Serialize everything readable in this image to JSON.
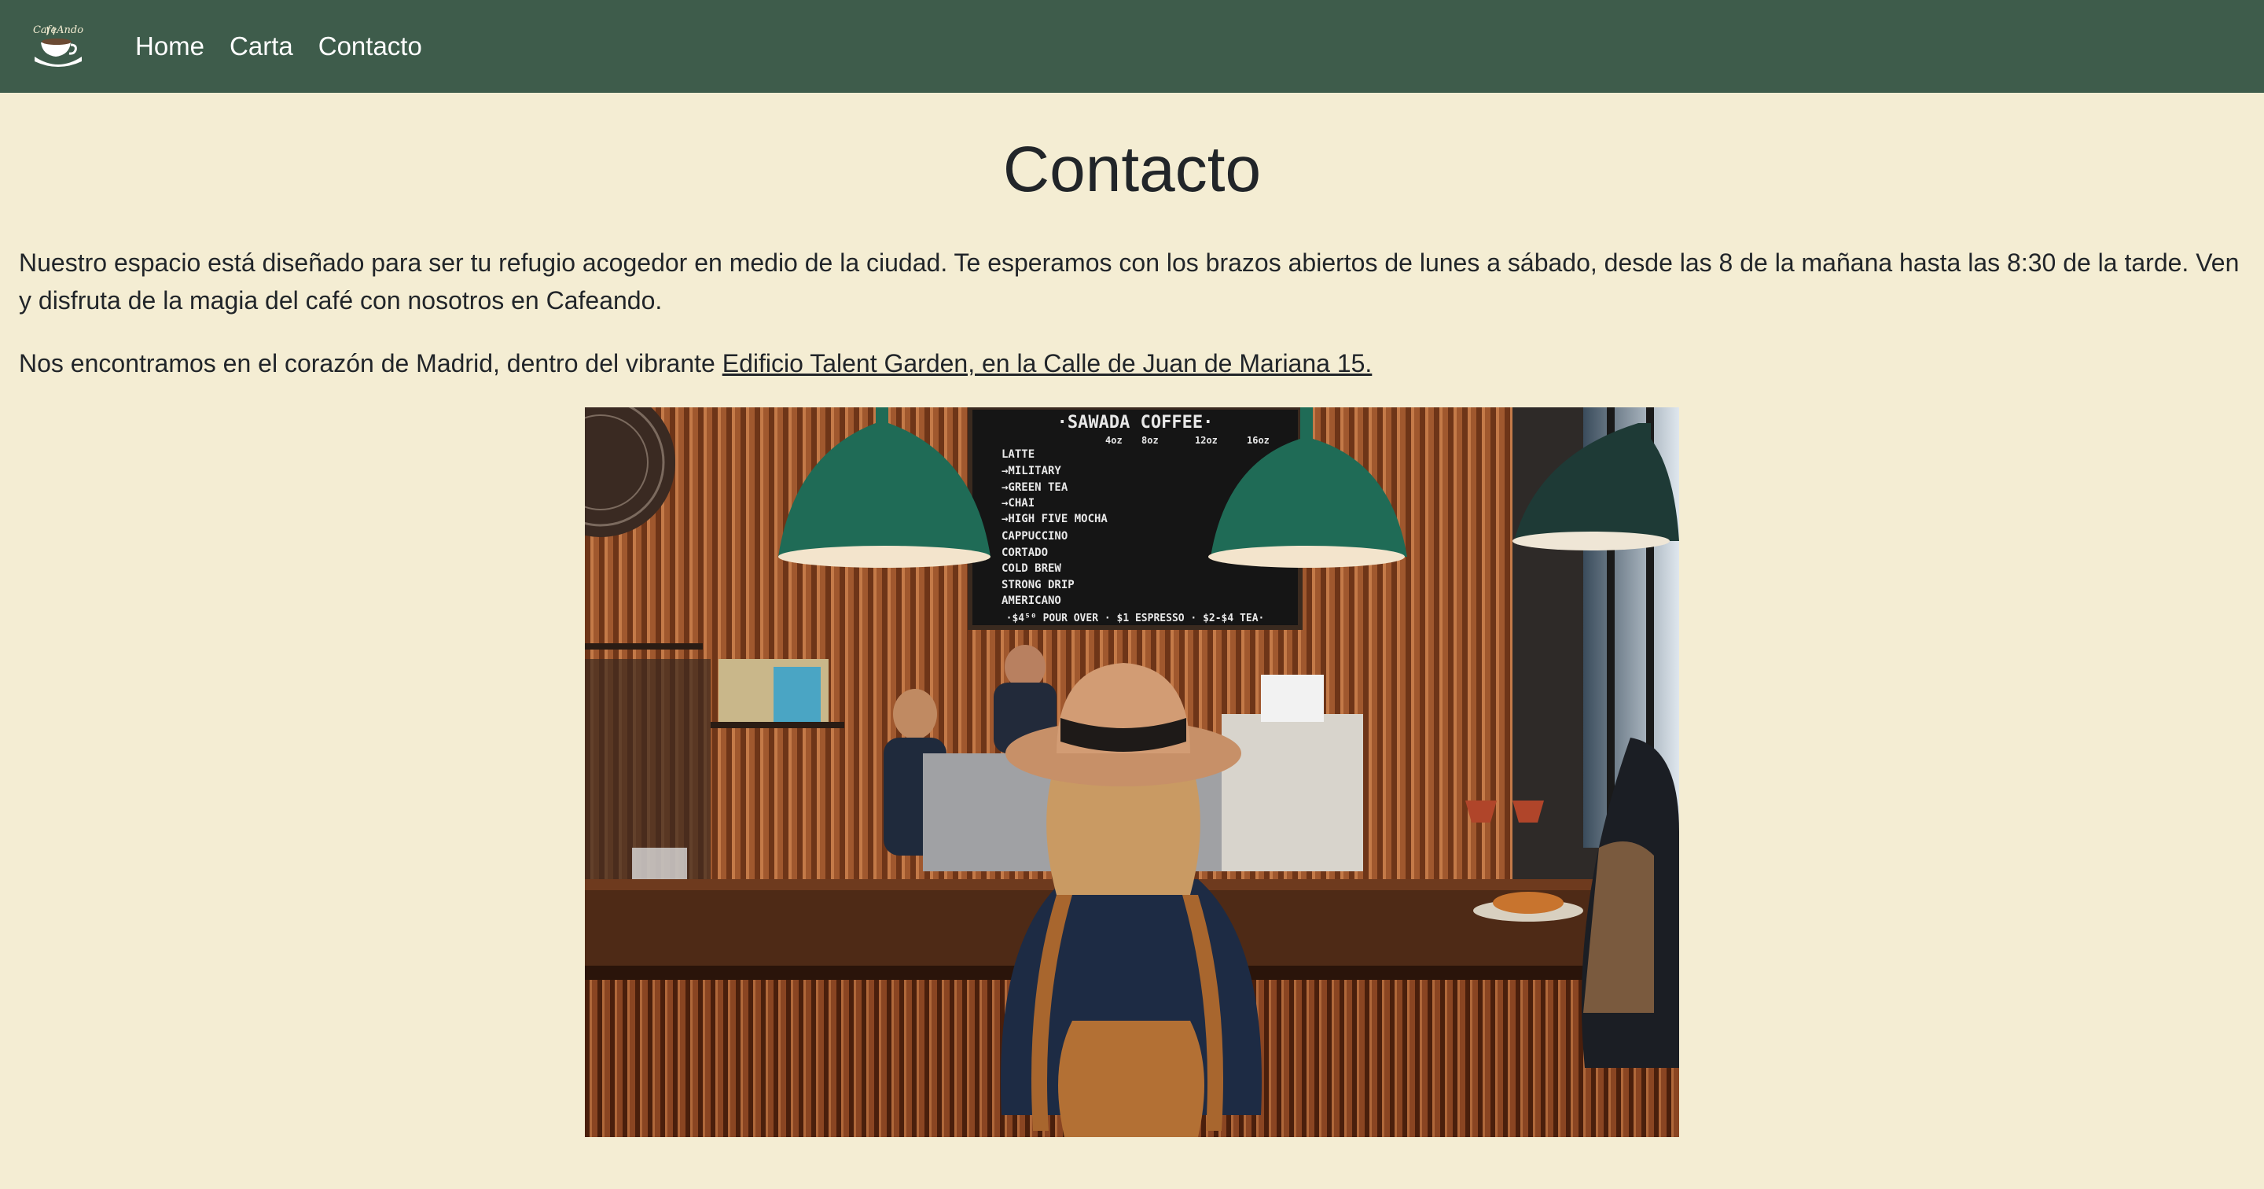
{
  "nav": {
    "logo_icon": "cafeando-coffee-cup-logo",
    "logo_text": "CafeAndo",
    "links": [
      {
        "label": "Home"
      },
      {
        "label": "Carta"
      },
      {
        "label": "Contacto"
      }
    ],
    "colors": {
      "background": "#3e5c4b",
      "text": "#ffffff"
    }
  },
  "page": {
    "background": "#f4edd3",
    "title": "Contacto",
    "intro_text": "Nuestro espacio está diseñado para ser tu refugio acogedor en medio de la ciudad. Te esperamos con los brazos abiertos de lunes a sábado, desde las 8 de la mañana hasta las 8:30 de la tarde. Ven y disfruta de la magia del café con nosotros en Cafeando.",
    "location_prefix": "Nos encontramos en el corazón de Madrid, dentro del vibrante ",
    "location_link": "Edificio Talent Garden, en la Calle de Juan de Mariana 15."
  },
  "photo": {
    "subject": "cafe-interior-photo",
    "menu_board": {
      "header": "·SAWADA   COFFEE·",
      "sizes": [
        "4oz",
        "8oz",
        "12oz",
        "16oz"
      ],
      "items": [
        "LATTE",
        "→MILITARY",
        "→GREEN TEA",
        "→CHAI",
        "→HIGH FIVE MOCHA",
        "CAPPUCCINO",
        "CORTADO",
        "COLD BREW",
        "STRONG DRIP",
        "AMERICANO"
      ],
      "footer": "·$4⁵⁰ POUR OVER · $1 ESPRESSO · $2-$4 TEA·"
    }
  }
}
